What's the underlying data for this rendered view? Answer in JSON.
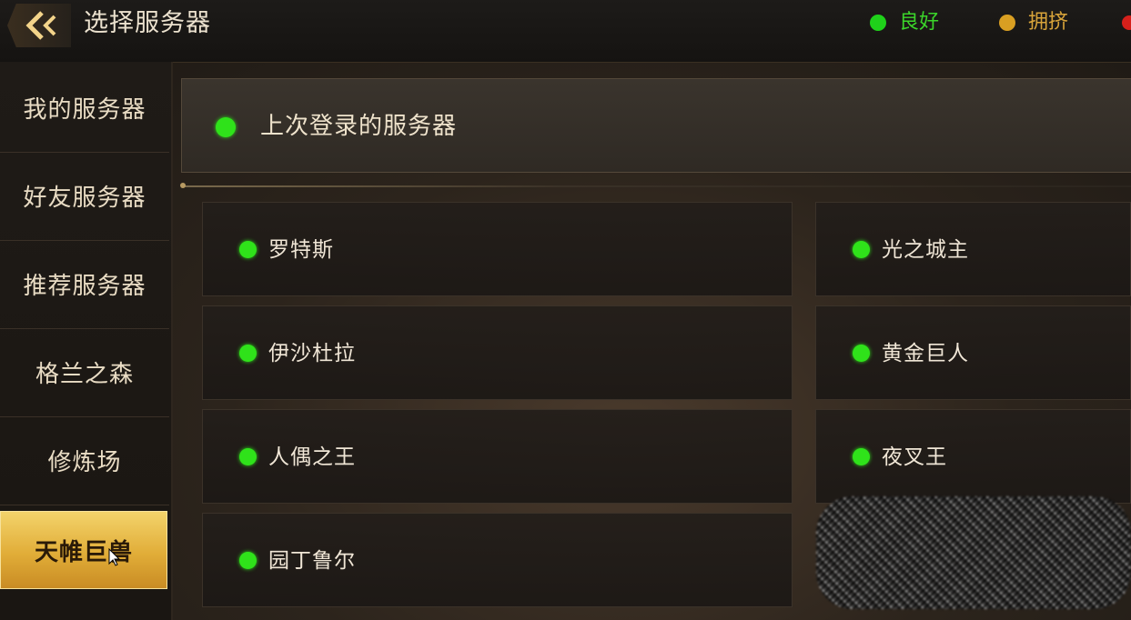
{
  "header": {
    "title": "选择服务器",
    "back_icon": "double-chevron-left-icon",
    "legend": [
      {
        "label": "良好",
        "color": "#3bd52a"
      },
      {
        "label": "拥挤",
        "color": "#d8a43a"
      }
    ]
  },
  "sidebar": {
    "items": [
      {
        "label": "我的服务器"
      },
      {
        "label": "好友服务器"
      },
      {
        "label": "推荐服务器"
      },
      {
        "label": "格兰之森"
      },
      {
        "label": "修炼场"
      },
      {
        "label": "天帷巨兽",
        "selected": true
      }
    ]
  },
  "last_login": {
    "label": "上次登录的服务器",
    "status_color": "#2fe21a"
  },
  "servers": [
    {
      "name": "罗特斯",
      "status": "良好"
    },
    {
      "name": "光之城主",
      "status": "良好"
    },
    {
      "name": "伊沙杜拉",
      "status": "良好"
    },
    {
      "name": "黄金巨人",
      "status": "良好"
    },
    {
      "name": "人偶之王",
      "status": "良好"
    },
    {
      "name": "夜叉王",
      "status": "良好"
    },
    {
      "name": "园丁鲁尔",
      "status": "良好"
    }
  ]
}
